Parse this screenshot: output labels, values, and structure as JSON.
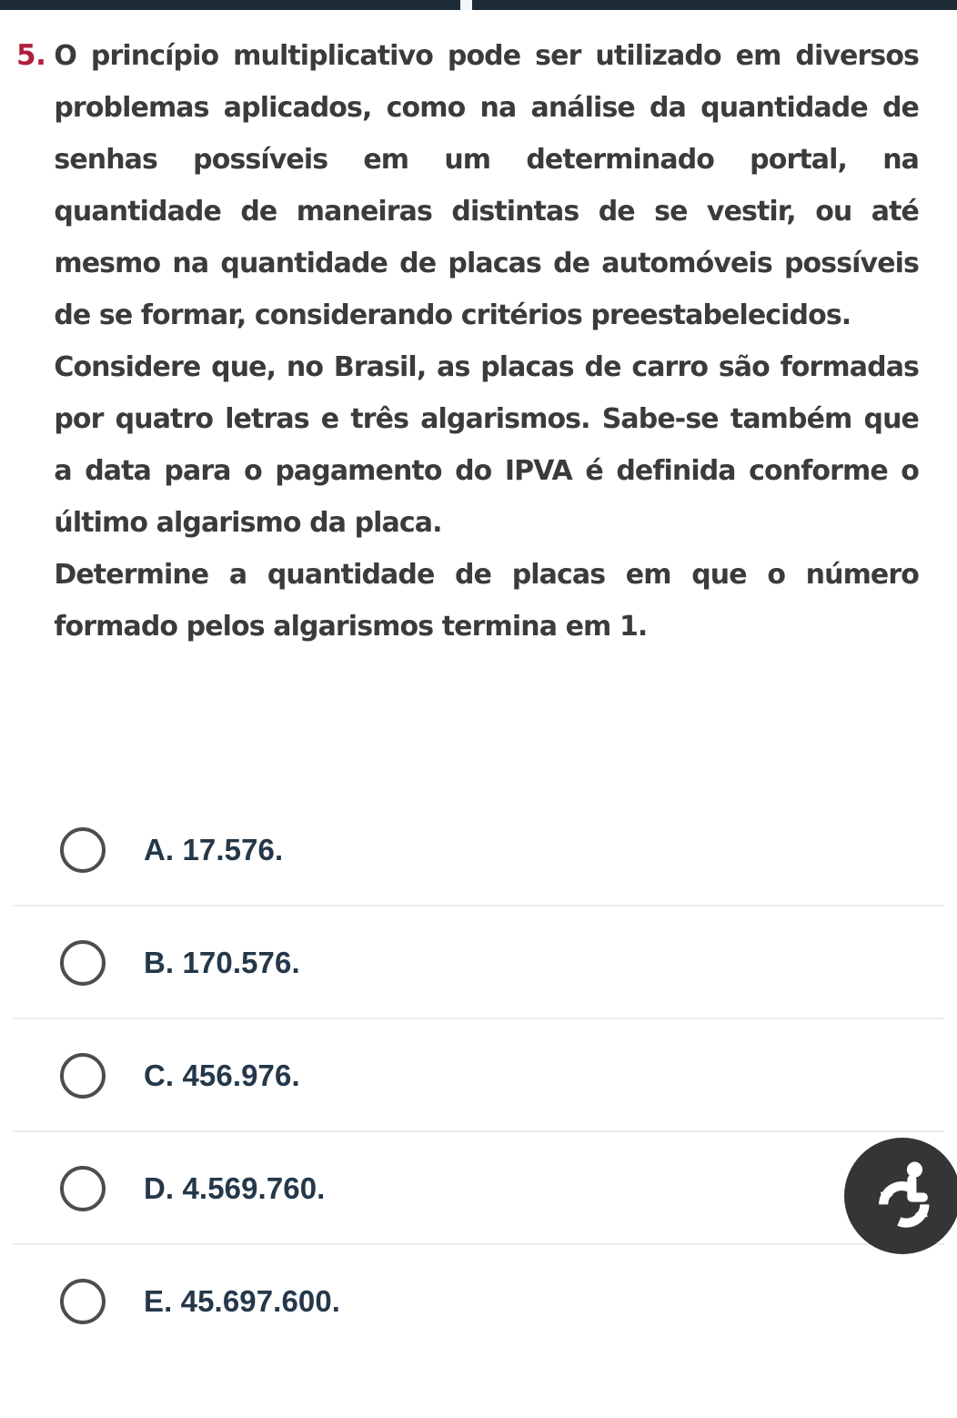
{
  "status_bar": {
    "present": true,
    "color": "#1e2c38",
    "notch_gap_color": "#f4f6f7"
  },
  "question": {
    "number": "5.",
    "number_color": "#b01e3c",
    "text_color": "#3b3b3b",
    "paragraphs": [
      "O princípio multiplicativo pode ser utilizado em diversos problemas aplicados, como na análise da quantidade de senhas possíveis em um determinado portal, na quantidade de maneiras distintas de se vestir, ou até mesmo na quantidade de placas de automóveis possíveis de se formar, considerando critérios preestabelecidos.",
      "Considere que, no Brasil, as placas de carro são formadas por quatro letras e três algarismos. Sabe-se também que a data para o pagamento do IPVA é definida conforme o último algarismo da placa.",
      "Determine a quantidade de placas em que o número formado pelos algarismos termina em 1."
    ]
  },
  "options": {
    "accent_color": "#24384a",
    "radio_color": "#4d4d4d",
    "divider_color": "#e9ebec",
    "selected": null,
    "items": [
      {
        "id": "A",
        "label": "A. 17.576.",
        "value": "17.576"
      },
      {
        "id": "B",
        "label": "B. 170.576.",
        "value": "170.576"
      },
      {
        "id": "C",
        "label": "C. 456.976.",
        "value": "456.976"
      },
      {
        "id": "D",
        "label": "D. 4.569.760.",
        "value": "4.569.760"
      },
      {
        "id": "E",
        "label": "E. 45.697.600.",
        "value": "45.697.600"
      }
    ]
  },
  "accessibility_widget": {
    "icon": "accessibility-person-icon",
    "background_color": "#353535",
    "icon_color": "#ffffff"
  }
}
